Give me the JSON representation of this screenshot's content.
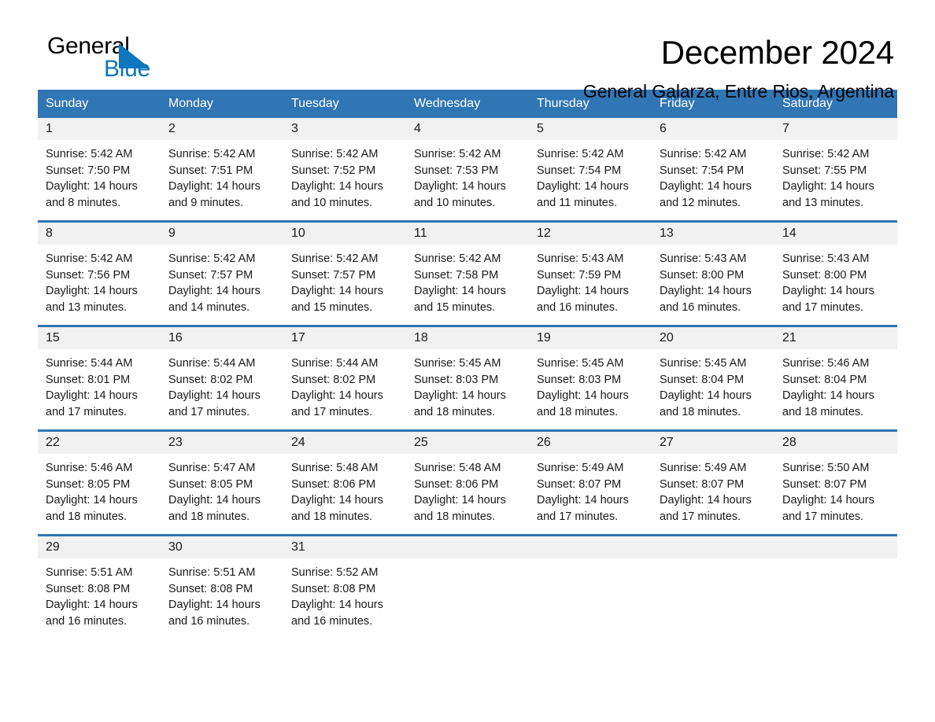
{
  "logo": {
    "word_one": "General",
    "word_two": "Blue",
    "triangle_icon": "triangle-icon",
    "blue_hex": "#0d76bd"
  },
  "header": {
    "month_title": "December 2024",
    "location": "General Galarza, Entre Rios, Argentina"
  },
  "theme": {
    "header_blue": "#3075b4",
    "band_gray": "#f1f1f1",
    "text_black": "#1a1a1a"
  },
  "weekdays": [
    "Sunday",
    "Monday",
    "Tuesday",
    "Wednesday",
    "Thursday",
    "Friday",
    "Saturday"
  ],
  "weeks": [
    [
      {
        "day": "1",
        "sunrise": "Sunrise: 5:42 AM",
        "sunset": "Sunset: 7:50 PM",
        "daylight_line1": "Daylight: 14 hours",
        "daylight_line2": "and 8 minutes."
      },
      {
        "day": "2",
        "sunrise": "Sunrise: 5:42 AM",
        "sunset": "Sunset: 7:51 PM",
        "daylight_line1": "Daylight: 14 hours",
        "daylight_line2": "and 9 minutes."
      },
      {
        "day": "3",
        "sunrise": "Sunrise: 5:42 AM",
        "sunset": "Sunset: 7:52 PM",
        "daylight_line1": "Daylight: 14 hours",
        "daylight_line2": "and 10 minutes."
      },
      {
        "day": "4",
        "sunrise": "Sunrise: 5:42 AM",
        "sunset": "Sunset: 7:53 PM",
        "daylight_line1": "Daylight: 14 hours",
        "daylight_line2": "and 10 minutes."
      },
      {
        "day": "5",
        "sunrise": "Sunrise: 5:42 AM",
        "sunset": "Sunset: 7:54 PM",
        "daylight_line1": "Daylight: 14 hours",
        "daylight_line2": "and 11 minutes."
      },
      {
        "day": "6",
        "sunrise": "Sunrise: 5:42 AM",
        "sunset": "Sunset: 7:54 PM",
        "daylight_line1": "Daylight: 14 hours",
        "daylight_line2": "and 12 minutes."
      },
      {
        "day": "7",
        "sunrise": "Sunrise: 5:42 AM",
        "sunset": "Sunset: 7:55 PM",
        "daylight_line1": "Daylight: 14 hours",
        "daylight_line2": "and 13 minutes."
      }
    ],
    [
      {
        "day": "8",
        "sunrise": "Sunrise: 5:42 AM",
        "sunset": "Sunset: 7:56 PM",
        "daylight_line1": "Daylight: 14 hours",
        "daylight_line2": "and 13 minutes."
      },
      {
        "day": "9",
        "sunrise": "Sunrise: 5:42 AM",
        "sunset": "Sunset: 7:57 PM",
        "daylight_line1": "Daylight: 14 hours",
        "daylight_line2": "and 14 minutes."
      },
      {
        "day": "10",
        "sunrise": "Sunrise: 5:42 AM",
        "sunset": "Sunset: 7:57 PM",
        "daylight_line1": "Daylight: 14 hours",
        "daylight_line2": "and 15 minutes."
      },
      {
        "day": "11",
        "sunrise": "Sunrise: 5:42 AM",
        "sunset": "Sunset: 7:58 PM",
        "daylight_line1": "Daylight: 14 hours",
        "daylight_line2": "and 15 minutes."
      },
      {
        "day": "12",
        "sunrise": "Sunrise: 5:43 AM",
        "sunset": "Sunset: 7:59 PM",
        "daylight_line1": "Daylight: 14 hours",
        "daylight_line2": "and 16 minutes."
      },
      {
        "day": "13",
        "sunrise": "Sunrise: 5:43 AM",
        "sunset": "Sunset: 8:00 PM",
        "daylight_line1": "Daylight: 14 hours",
        "daylight_line2": "and 16 minutes."
      },
      {
        "day": "14",
        "sunrise": "Sunrise: 5:43 AM",
        "sunset": "Sunset: 8:00 PM",
        "daylight_line1": "Daylight: 14 hours",
        "daylight_line2": "and 17 minutes."
      }
    ],
    [
      {
        "day": "15",
        "sunrise": "Sunrise: 5:44 AM",
        "sunset": "Sunset: 8:01 PM",
        "daylight_line1": "Daylight: 14 hours",
        "daylight_line2": "and 17 minutes."
      },
      {
        "day": "16",
        "sunrise": "Sunrise: 5:44 AM",
        "sunset": "Sunset: 8:02 PM",
        "daylight_line1": "Daylight: 14 hours",
        "daylight_line2": "and 17 minutes."
      },
      {
        "day": "17",
        "sunrise": "Sunrise: 5:44 AM",
        "sunset": "Sunset: 8:02 PM",
        "daylight_line1": "Daylight: 14 hours",
        "daylight_line2": "and 17 minutes."
      },
      {
        "day": "18",
        "sunrise": "Sunrise: 5:45 AM",
        "sunset": "Sunset: 8:03 PM",
        "daylight_line1": "Daylight: 14 hours",
        "daylight_line2": "and 18 minutes."
      },
      {
        "day": "19",
        "sunrise": "Sunrise: 5:45 AM",
        "sunset": "Sunset: 8:03 PM",
        "daylight_line1": "Daylight: 14 hours",
        "daylight_line2": "and 18 minutes."
      },
      {
        "day": "20",
        "sunrise": "Sunrise: 5:45 AM",
        "sunset": "Sunset: 8:04 PM",
        "daylight_line1": "Daylight: 14 hours",
        "daylight_line2": "and 18 minutes."
      },
      {
        "day": "21",
        "sunrise": "Sunrise: 5:46 AM",
        "sunset": "Sunset: 8:04 PM",
        "daylight_line1": "Daylight: 14 hours",
        "daylight_line2": "and 18 minutes."
      }
    ],
    [
      {
        "day": "22",
        "sunrise": "Sunrise: 5:46 AM",
        "sunset": "Sunset: 8:05 PM",
        "daylight_line1": "Daylight: 14 hours",
        "daylight_line2": "and 18 minutes."
      },
      {
        "day": "23",
        "sunrise": "Sunrise: 5:47 AM",
        "sunset": "Sunset: 8:05 PM",
        "daylight_line1": "Daylight: 14 hours",
        "daylight_line2": "and 18 minutes."
      },
      {
        "day": "24",
        "sunrise": "Sunrise: 5:48 AM",
        "sunset": "Sunset: 8:06 PM",
        "daylight_line1": "Daylight: 14 hours",
        "daylight_line2": "and 18 minutes."
      },
      {
        "day": "25",
        "sunrise": "Sunrise: 5:48 AM",
        "sunset": "Sunset: 8:06 PM",
        "daylight_line1": "Daylight: 14 hours",
        "daylight_line2": "and 18 minutes."
      },
      {
        "day": "26",
        "sunrise": "Sunrise: 5:49 AM",
        "sunset": "Sunset: 8:07 PM",
        "daylight_line1": "Daylight: 14 hours",
        "daylight_line2": "and 17 minutes."
      },
      {
        "day": "27",
        "sunrise": "Sunrise: 5:49 AM",
        "sunset": "Sunset: 8:07 PM",
        "daylight_line1": "Daylight: 14 hours",
        "daylight_line2": "and 17 minutes."
      },
      {
        "day": "28",
        "sunrise": "Sunrise: 5:50 AM",
        "sunset": "Sunset: 8:07 PM",
        "daylight_line1": "Daylight: 14 hours",
        "daylight_line2": "and 17 minutes."
      }
    ],
    [
      {
        "day": "29",
        "sunrise": "Sunrise: 5:51 AM",
        "sunset": "Sunset: 8:08 PM",
        "daylight_line1": "Daylight: 14 hours",
        "daylight_line2": "and 16 minutes."
      },
      {
        "day": "30",
        "sunrise": "Sunrise: 5:51 AM",
        "sunset": "Sunset: 8:08 PM",
        "daylight_line1": "Daylight: 14 hours",
        "daylight_line2": "and 16 minutes."
      },
      {
        "day": "31",
        "sunrise": "Sunrise: 5:52 AM",
        "sunset": "Sunset: 8:08 PM",
        "daylight_line1": "Daylight: 14 hours",
        "daylight_line2": "and 16 minutes."
      },
      {
        "day": "",
        "sunrise": "",
        "sunset": "",
        "daylight_line1": "",
        "daylight_line2": ""
      },
      {
        "day": "",
        "sunrise": "",
        "sunset": "",
        "daylight_line1": "",
        "daylight_line2": ""
      },
      {
        "day": "",
        "sunrise": "",
        "sunset": "",
        "daylight_line1": "",
        "daylight_line2": ""
      },
      {
        "day": "",
        "sunrise": "",
        "sunset": "",
        "daylight_line1": "",
        "daylight_line2": ""
      }
    ]
  ]
}
